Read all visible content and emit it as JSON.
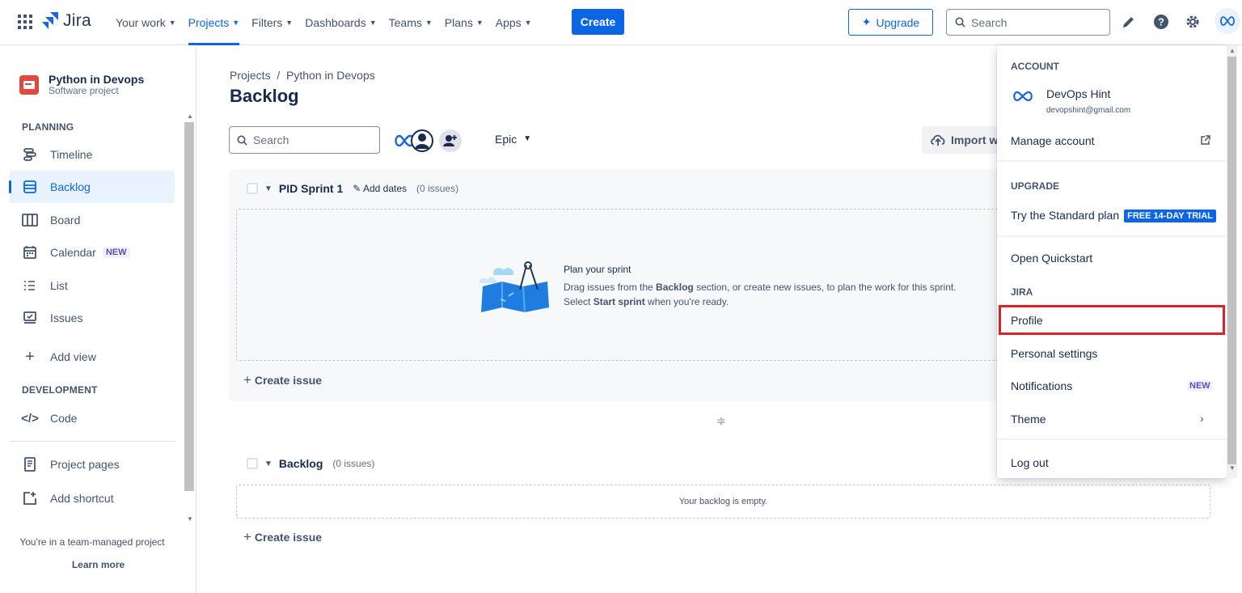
{
  "topnav": {
    "logo_text": "Jira",
    "items": [
      {
        "label": "Your work"
      },
      {
        "label": "Projects"
      },
      {
        "label": "Filters"
      },
      {
        "label": "Dashboards"
      },
      {
        "label": "Teams"
      },
      {
        "label": "Plans"
      },
      {
        "label": "Apps"
      }
    ],
    "create_label": "Create",
    "upgrade_label": "Upgrade",
    "search_placeholder": "Search"
  },
  "sidebar": {
    "project_name": "Python in Devops",
    "project_type": "Software project",
    "planning_heading": "PLANNING",
    "development_heading": "DEVELOPMENT",
    "items": [
      {
        "label": "Timeline"
      },
      {
        "label": "Backlog"
      },
      {
        "label": "Board"
      },
      {
        "label": "Calendar",
        "badge": "NEW"
      },
      {
        "label": "List"
      },
      {
        "label": "Issues"
      },
      {
        "label": "Add view"
      },
      {
        "label": "Code"
      },
      {
        "label": "Project pages"
      },
      {
        "label": "Add shortcut"
      }
    ],
    "footer_text": "You're in a team-managed project",
    "learn_more": "Learn more"
  },
  "main": {
    "breadcrumb": "Projects  /  Python in Devops",
    "title": "Backlog",
    "search_placeholder": "Search",
    "epic_label": "Epic",
    "import_label": "Import w",
    "sprint": {
      "name": "PID Sprint 1",
      "add_dates": "Add dates",
      "count": "(0 issues)",
      "plan_title": "Plan your sprint",
      "plan_text_1": "Drag issues from the ",
      "plan_text_bold1": "Backlog",
      "plan_text_2": " section, or create new issues, to plan the work for this sprint. Select ",
      "plan_text_bold2": "Start sprint",
      "plan_text_3": " when you're ready.",
      "create_issue": "Create issue"
    },
    "backlog": {
      "name": "Backlog",
      "count": "(0 issues)",
      "empty_text": "Your backlog is empty.",
      "create_issue": "Create issue"
    }
  },
  "dropdown": {
    "account_heading": "ACCOUNT",
    "user_name": "DevOps Hint",
    "user_email": "devopshint@gmail.com",
    "manage_account": "Manage account",
    "upgrade_heading": "UPGRADE",
    "standard_plan": "Try the Standard plan",
    "trial_badge": "FREE 14-DAY TRIAL",
    "open_quickstart": "Open Quickstart",
    "jira_heading": "JIRA",
    "profile": "Profile",
    "personal_settings": "Personal settings",
    "notifications": "Notifications",
    "notifications_badge": "NEW",
    "theme": "Theme",
    "log_out": "Log out"
  },
  "colors": {
    "accent": "#0c66e4",
    "highlight_box": "#e31e24"
  }
}
